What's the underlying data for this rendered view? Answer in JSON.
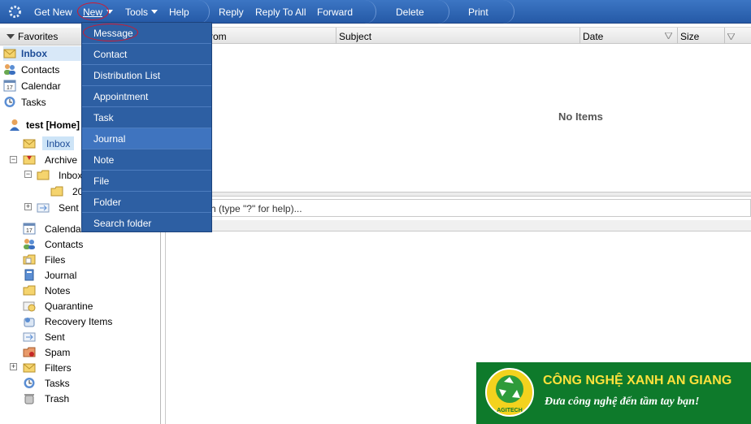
{
  "toolbar": {
    "get_new": "Get New",
    "new": "New",
    "tools": "Tools",
    "help": "Help",
    "reply": "Reply",
    "reply_all": "Reply To All",
    "forward": "Forward",
    "delete": "Delete",
    "print": "Print"
  },
  "favorites": {
    "header": "Favorites",
    "items": [
      "Inbox",
      "Contacts",
      "Calendar",
      "Tasks"
    ]
  },
  "tree": {
    "account": "test [Home]",
    "inbox": "Inbox",
    "archive": "Archive",
    "archive_inbox": "Inbox",
    "archive_year": "20",
    "sent_sub": "Sent",
    "items": [
      "Calendar",
      "Contacts",
      "Files",
      "Journal",
      "Notes",
      "Quarantine",
      "Recovery Items",
      "Sent",
      "Spam",
      "Filters",
      "Tasks",
      "Trash"
    ]
  },
  "columns": {
    "from": "rom",
    "subject": "Subject",
    "date": "Date",
    "size": "Size"
  },
  "list": {
    "empty": "No Items"
  },
  "search": {
    "hint": "h (type \"?\" for help)..."
  },
  "new_menu": {
    "items": [
      "Message",
      "Contact",
      "Distribution List",
      "Appointment",
      "Task",
      "Journal",
      "Note",
      "File",
      "Folder",
      "Search folder"
    ]
  },
  "logo": {
    "title": "CÔNG NGHỆ XANH AN GIANG",
    "slogan": "Đưa công nghệ đến tầm tay bạn!",
    "mark": "AGITECH"
  },
  "colors": {
    "toolbar": "#2d63b0",
    "menu": "#2d5fa3",
    "highlight": "#d3182e",
    "logo_bg": "#0e7a2b",
    "logo_title": "#ffe13c"
  }
}
